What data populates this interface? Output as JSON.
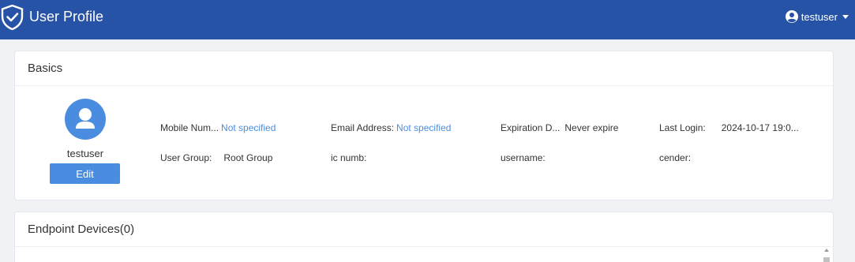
{
  "header": {
    "title": "User Profile",
    "user": "testuser",
    "brand_color": "#2653a6"
  },
  "basics": {
    "title": "Basics",
    "avatar_name": "testuser",
    "edit_label": "Edit",
    "fields": {
      "mobile_label": "Mobile Num...",
      "mobile_value": "Not specified",
      "email_label": "Email Address:",
      "email_value": "Not specified",
      "expiration_label": "Expiration D...",
      "expiration_value": "Never expire",
      "last_login_label": "Last Login:",
      "last_login_value": "2024-10-17 19:0...",
      "group_label": "User Group:",
      "group_value": "Root Group",
      "ic_label": "ic numb:",
      "username_label": "username:",
      "gender_label": "cender:"
    }
  },
  "endpoints": {
    "title": "Endpoint Devices(0)"
  },
  "icons": {
    "logo": "shield-check-icon",
    "user": "user-circle-icon",
    "caret": "caret-down-icon",
    "avatar": "person-icon"
  },
  "colors": {
    "accent": "#4a8de0",
    "background": "#f0f2f5"
  }
}
